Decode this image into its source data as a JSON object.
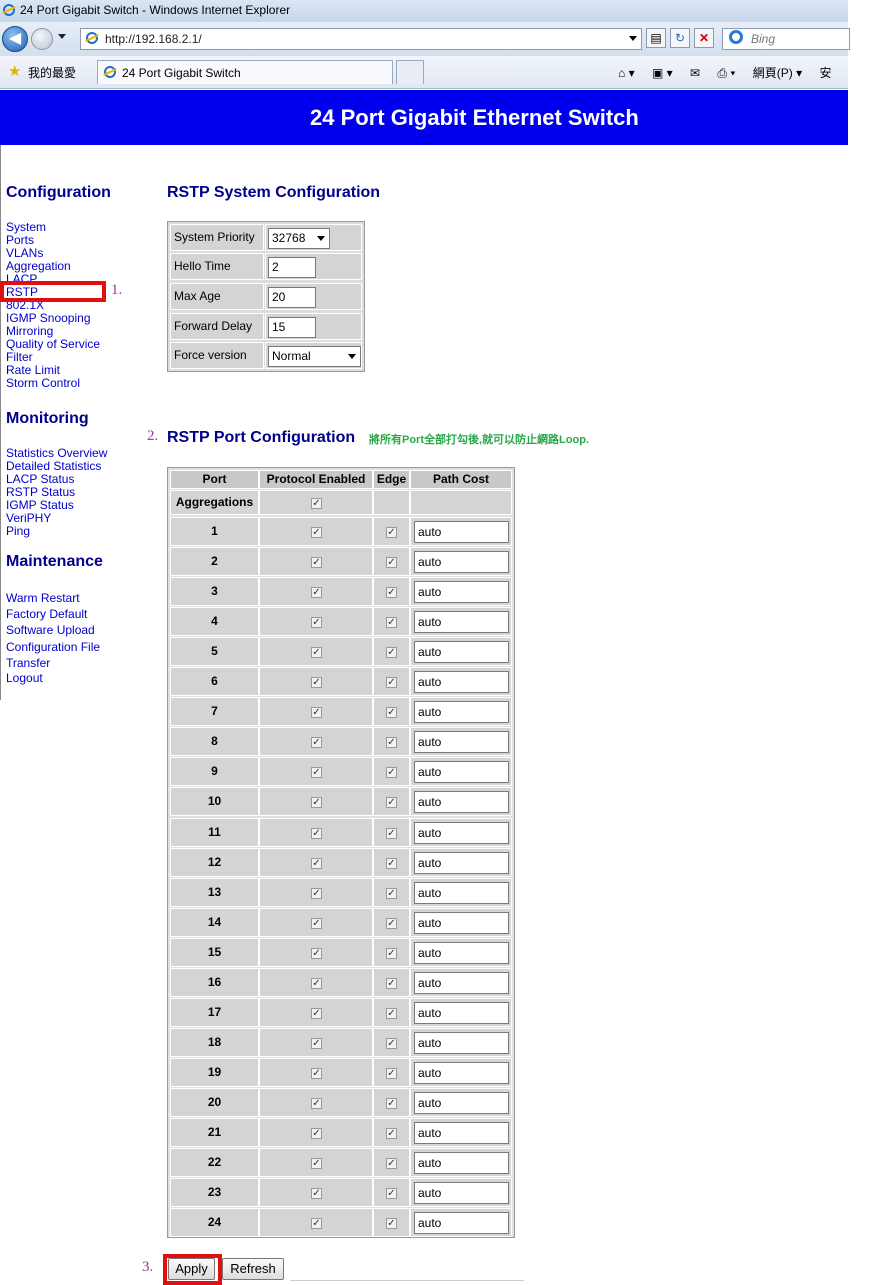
{
  "window": {
    "title": "24 Port Gigabit Switch - Windows Internet Explorer"
  },
  "browser": {
    "url": "http://192.168.2.1/",
    "search_placeholder": "Bing",
    "favorites_label": "我的最愛",
    "tab_title": "24 Port Gigabit Switch",
    "toolbar": [
      "網頁(P) ▾",
      "安"
    ]
  },
  "banner": {
    "title": "24 Port Gigabit Ethernet Switch"
  },
  "sidebar": {
    "configuration": {
      "heading": "Configuration",
      "items": [
        "System",
        "Ports",
        "VLANs",
        "Aggregation",
        "LACP",
        "RSTP",
        "802.1X",
        "IGMP Snooping",
        "Mirroring",
        "Quality of Service",
        "Filter",
        "Rate Limit",
        "Storm Control"
      ]
    },
    "monitoring": {
      "heading": "Monitoring",
      "items": [
        "Statistics Overview",
        "Detailed Statistics",
        "LACP Status",
        "RSTP Status",
        "IGMP Status",
        "VeriPHY",
        "Ping"
      ]
    },
    "maintenance": {
      "heading": "Maintenance",
      "items": [
        "Warm Restart",
        "Factory Default",
        "Software Upload",
        "Configuration File Transfer",
        "Logout"
      ]
    }
  },
  "annotations": {
    "step1": "1.",
    "step2": "2.",
    "step3": "3.",
    "note": "將所有Port全部打勾後,就可以防止網路Loop."
  },
  "rstp_system": {
    "title": "RSTP System Configuration",
    "fields": [
      {
        "label": "System Priority",
        "value": "32768"
      },
      {
        "label": "Hello Time",
        "value": "2"
      },
      {
        "label": "Max Age",
        "value": "20"
      },
      {
        "label": "Forward Delay",
        "value": "15"
      },
      {
        "label": "Force version",
        "value": "Normal"
      }
    ]
  },
  "rstp_port": {
    "title": "RSTP Port Configuration",
    "headers": [
      "Port",
      "Protocol Enabled",
      "Edge",
      "Path Cost"
    ],
    "aggregations_label": "Aggregations",
    "ports": [
      {
        "port": "1",
        "protocol_enabled": true,
        "edge": true,
        "path_cost": "auto"
      },
      {
        "port": "2",
        "protocol_enabled": true,
        "edge": true,
        "path_cost": "auto"
      },
      {
        "port": "3",
        "protocol_enabled": true,
        "edge": true,
        "path_cost": "auto"
      },
      {
        "port": "4",
        "protocol_enabled": true,
        "edge": true,
        "path_cost": "auto"
      },
      {
        "port": "5",
        "protocol_enabled": true,
        "edge": true,
        "path_cost": "auto"
      },
      {
        "port": "6",
        "protocol_enabled": true,
        "edge": true,
        "path_cost": "auto"
      },
      {
        "port": "7",
        "protocol_enabled": true,
        "edge": true,
        "path_cost": "auto"
      },
      {
        "port": "8",
        "protocol_enabled": true,
        "edge": true,
        "path_cost": "auto"
      },
      {
        "port": "9",
        "protocol_enabled": true,
        "edge": true,
        "path_cost": "auto"
      },
      {
        "port": "10",
        "protocol_enabled": true,
        "edge": true,
        "path_cost": "auto"
      },
      {
        "port": "11",
        "protocol_enabled": true,
        "edge": true,
        "path_cost": "auto"
      },
      {
        "port": "12",
        "protocol_enabled": true,
        "edge": true,
        "path_cost": "auto"
      },
      {
        "port": "13",
        "protocol_enabled": true,
        "edge": true,
        "path_cost": "auto"
      },
      {
        "port": "14",
        "protocol_enabled": true,
        "edge": true,
        "path_cost": "auto"
      },
      {
        "port": "15",
        "protocol_enabled": true,
        "edge": true,
        "path_cost": "auto"
      },
      {
        "port": "16",
        "protocol_enabled": true,
        "edge": true,
        "path_cost": "auto"
      },
      {
        "port": "17",
        "protocol_enabled": true,
        "edge": true,
        "path_cost": "auto"
      },
      {
        "port": "18",
        "protocol_enabled": true,
        "edge": true,
        "path_cost": "auto"
      },
      {
        "port": "19",
        "protocol_enabled": true,
        "edge": true,
        "path_cost": "auto"
      },
      {
        "port": "20",
        "protocol_enabled": true,
        "edge": true,
        "path_cost": "auto"
      },
      {
        "port": "21",
        "protocol_enabled": true,
        "edge": true,
        "path_cost": "auto"
      },
      {
        "port": "22",
        "protocol_enabled": true,
        "edge": true,
        "path_cost": "auto"
      },
      {
        "port": "23",
        "protocol_enabled": true,
        "edge": true,
        "path_cost": "auto"
      },
      {
        "port": "24",
        "protocol_enabled": true,
        "edge": true,
        "path_cost": "auto"
      }
    ]
  },
  "buttons": {
    "apply": "Apply",
    "refresh": "Refresh"
  }
}
